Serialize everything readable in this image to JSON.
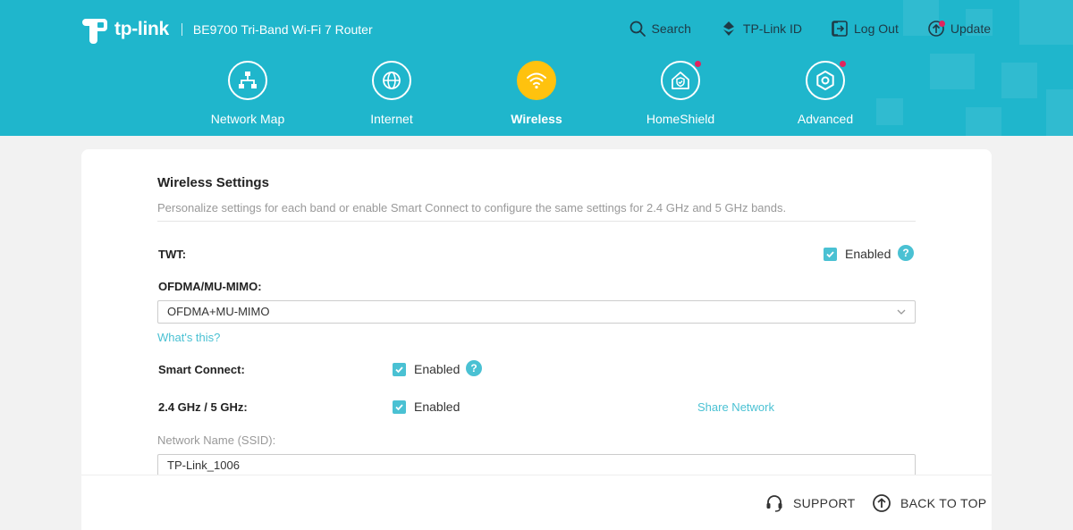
{
  "brand": {
    "logo_text": "tp-link",
    "model": "BE9700 Tri-Band Wi-Fi 7 Router"
  },
  "topnav": [
    {
      "label": "Search",
      "icon": "search-icon"
    },
    {
      "label": "TP-Link ID",
      "icon": "tplink-id-icon"
    },
    {
      "label": "Log Out",
      "icon": "logout-icon"
    },
    {
      "label": "Update",
      "icon": "update-icon",
      "has_notification": true
    }
  ],
  "mainnav": [
    {
      "label": "Network Map",
      "icon": "network-map-icon"
    },
    {
      "label": "Internet",
      "icon": "globe-icon"
    },
    {
      "label": "Wireless",
      "icon": "wifi-icon",
      "active": true
    },
    {
      "label": "HomeShield",
      "icon": "homeshield-icon",
      "has_notification": true
    },
    {
      "label": "Advanced",
      "icon": "advanced-gear-icon",
      "has_notification": true
    }
  ],
  "section": {
    "title": "Wireless Settings",
    "description": "Personalize settings for each band or enable Smart Connect to configure the same settings for 2.4 GHz and 5 GHz bands."
  },
  "twt": {
    "label": "TWT:",
    "checked": true,
    "check_label": "Enabled"
  },
  "ofdma": {
    "label": "OFDMA/MU-MIMO:",
    "value": "OFDMA+MU-MIMO",
    "help_link": "What's this?"
  },
  "smart_connect": {
    "label": "Smart Connect:",
    "checked": true,
    "check_label": "Enabled"
  },
  "band": {
    "label": "2.4 GHz / 5 GHz:",
    "checked": true,
    "check_label": "Enabled",
    "share_link": "Share Network"
  },
  "ssid": {
    "label": "Network Name (SSID):",
    "value": "TP-Link_1006"
  },
  "footer": {
    "support": "SUPPORT",
    "back_to_top": "BACK TO TOP"
  },
  "colors": {
    "header_bg": "#1fb6cc",
    "accent": "#4ac1d3",
    "active_nav": "#ffc20e",
    "notification": "#e0245e"
  }
}
